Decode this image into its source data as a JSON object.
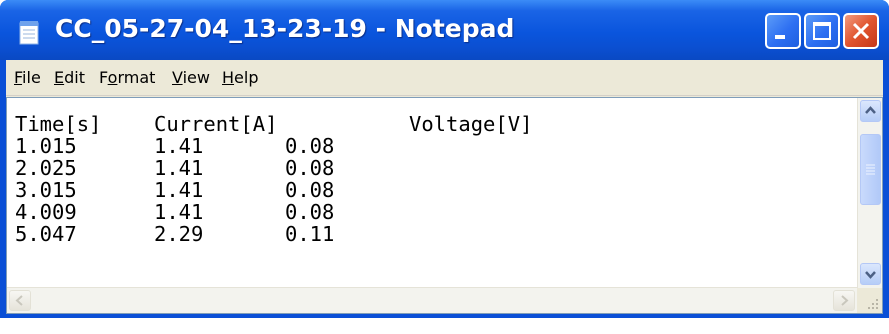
{
  "window": {
    "title": "CC_05-27-04_13-23-19 - Notepad",
    "buttons": {
      "minimize": "minimize-icon",
      "maximize": "maximize-icon",
      "close": "close-icon"
    }
  },
  "menu": [
    {
      "pre": "",
      "u": "F",
      "post": "ile"
    },
    {
      "pre": "",
      "u": "E",
      "post": "dit"
    },
    {
      "pre": "F",
      "u": "o",
      "post": "rmat"
    },
    {
      "pre": "",
      "u": "V",
      "post": "iew"
    },
    {
      "pre": "",
      "u": "H",
      "post": "elp"
    }
  ],
  "document": {
    "header": {
      "time": "Time[s]",
      "current": "Current[A]",
      "voltage": "Voltage[V]"
    },
    "rows": [
      {
        "time": "1.015",
        "current": "1.41",
        "voltage": "0.08"
      },
      {
        "time": "2.025",
        "current": "1.41",
        "voltage": "0.08"
      },
      {
        "time": "3.015",
        "current": "1.41",
        "voltage": "0.08"
      },
      {
        "time": "4.009",
        "current": "1.41",
        "voltage": "0.08"
      },
      {
        "time": "5.047",
        "current": "2.29",
        "voltage": "0.11"
      }
    ]
  },
  "colors": {
    "titlebar": "#0a55dd",
    "close_button": "#e1552f",
    "chrome": "#ece9d8"
  }
}
